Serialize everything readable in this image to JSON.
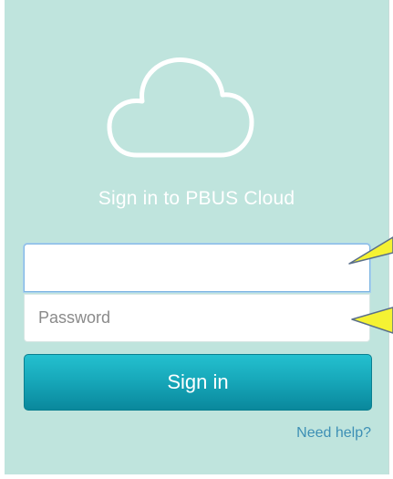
{
  "login": {
    "title": "Sign in to PBUS Cloud",
    "username": {
      "value": "",
      "placeholder": ""
    },
    "password": {
      "value": "",
      "placeholder": "Password"
    },
    "signin_label": "Sign in",
    "help_label": "Need help?"
  },
  "theme": {
    "panel_background": "#bfe4dd",
    "button_top": "#24c0cf",
    "button_bottom": "#0a889c",
    "link_color": "#3d8fb5",
    "callout_fill": "#f5f233"
  },
  "icons": {
    "logo": "cloud-outline-icon"
  }
}
